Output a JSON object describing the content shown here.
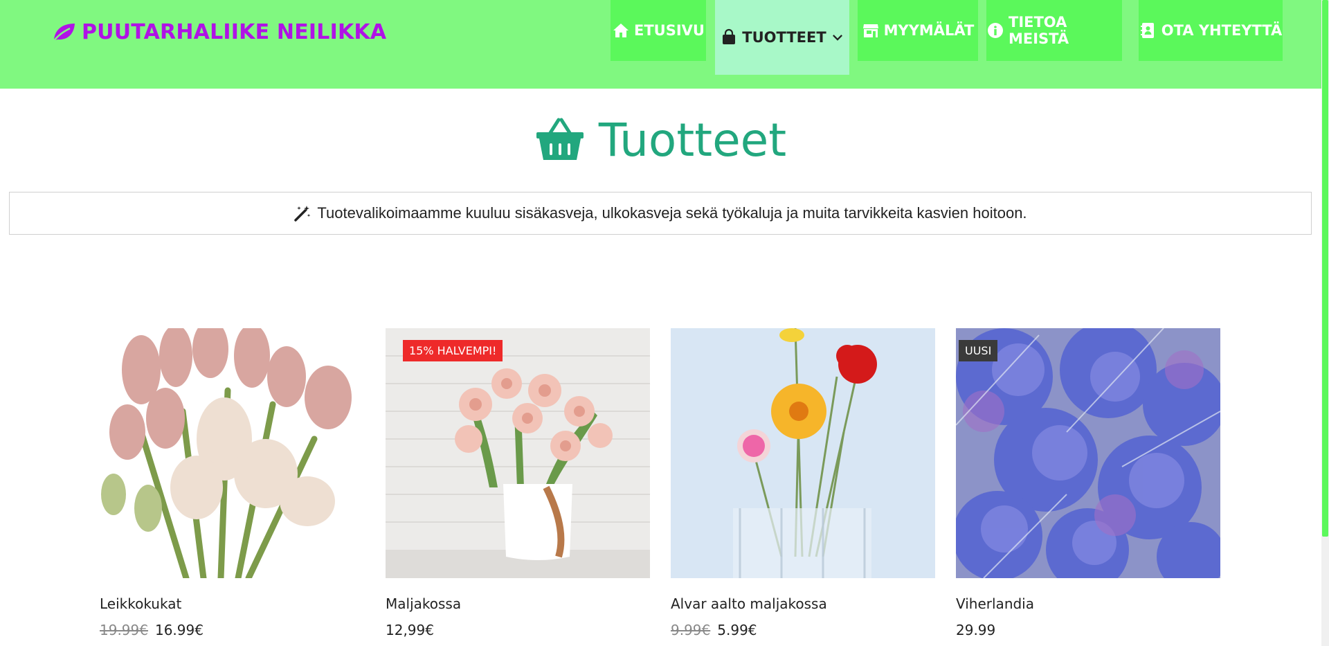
{
  "brand": {
    "name": "PUUTARHALIIKE NEILIKKA",
    "icon": "leaf-icon",
    "color": "#b012e6"
  },
  "nav": [
    {
      "label": "ETUSIVU",
      "icon": "home-icon"
    },
    {
      "label": "TUOTTEET",
      "icon": "shopping-bag-icon",
      "active": true,
      "dropdown": "chevron-down-icon"
    },
    {
      "label": "MYYMÄLÄT",
      "icon": "store-icon"
    },
    {
      "label": "TIETOA MEISTÄ",
      "icon": "info-icon"
    },
    {
      "label": "OTA YHTEYTTÄ",
      "icon": "contact-book-icon"
    }
  ],
  "page": {
    "title": "Tuotteet",
    "title_icon": "basket-icon",
    "intro": "Tuotevalikoimaamme kuuluu sisäkasveja, ulkokasveja sekä työkaluja ja muita tarvikkeita kasvien hoitoon.",
    "intro_icon": "magic-wand-icon"
  },
  "products": [
    {
      "name": "Leikkokukat",
      "old_price": "19.99€",
      "price": "16.99€",
      "badge": ""
    },
    {
      "name": "Maljakossa",
      "old_price": "",
      "price": "12,99€",
      "badge": "15% HALVEMPI!"
    },
    {
      "name": "Alvar aalto maljakossa",
      "old_price": "9.99€",
      "price": "5.99€",
      "badge": ""
    },
    {
      "name": "Viherlandia",
      "old_price": "",
      "price": "29.99",
      "badge": "UUSI"
    }
  ],
  "colors": {
    "header_bg": "#80f880",
    "nav_bg": "#5bf85b",
    "nav_active_bg": "#a8f8c8",
    "title": "#22a77e",
    "sale_badge": "#ee2a2a",
    "new_badge": "#3a3a3a"
  }
}
